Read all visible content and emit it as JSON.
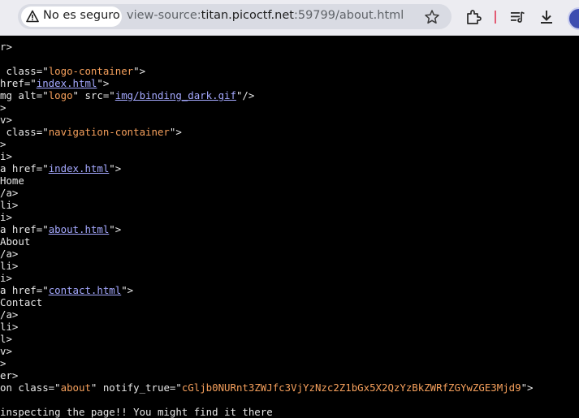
{
  "browser": {
    "security_label": "No es seguro",
    "url_scheme": "view-source:",
    "url_host": "titan.picoctf.net",
    "url_path": ":59799/about.html"
  },
  "source": {
    "l0": "r>",
    "l1_pre": " class=\"",
    "l1_val": "logo-container",
    "l1_post": "\">",
    "l2_pre": "href=\"",
    "l2_link": "index.html",
    "l2_post": "\">",
    "l3_pre": "mg alt=\"",
    "l3_val": "logo",
    "l3_mid": "\" src=\"",
    "l3_link": "img/binding_dark.gif",
    "l3_post": "\"/>",
    "l4": ">",
    "l5": "v>",
    "l6_pre": " class=\"",
    "l6_val": "navigation-container",
    "l6_post": "\">",
    "l7": ">",
    "l8": "i>",
    "l9_pre": "a href=\"",
    "l9_link": "index.html",
    "l9_post": "\">",
    "l10": "Home",
    "l11": "/a>",
    "l12": "li>",
    "l13": "i>",
    "l14_pre": "a href=\"",
    "l14_link": "about.html",
    "l14_post": "\">",
    "l15": "About",
    "l16": "/a>",
    "l17": "li>",
    "l18": "i>",
    "l19_pre": "a href=\"",
    "l19_link": "contact.html",
    "l19_post": "\">",
    "l20": "Contact",
    "l21": "/a>",
    "l22": "li>",
    "l23": "l>",
    "l24": "v>",
    "l25": ">",
    "l26": "er>",
    "l27_pre": "on class=\"",
    "l27_val": "about",
    "l27_mid": "\" notify_true=\"",
    "l27_val2": "cGljb0NURnt3ZWJfc3VjYzNzc2Z1bGx5X2QzYzBkZWRfZGYwZGE3Mjd9",
    "l27_post": "\">",
    "l28": "",
    "l29": "inspecting the page!! You might find it there"
  },
  "colors": {
    "background": "#000000",
    "attr_value": "#f6a05c",
    "link": "#a5a9ff",
    "text": "#e8e8e8"
  }
}
